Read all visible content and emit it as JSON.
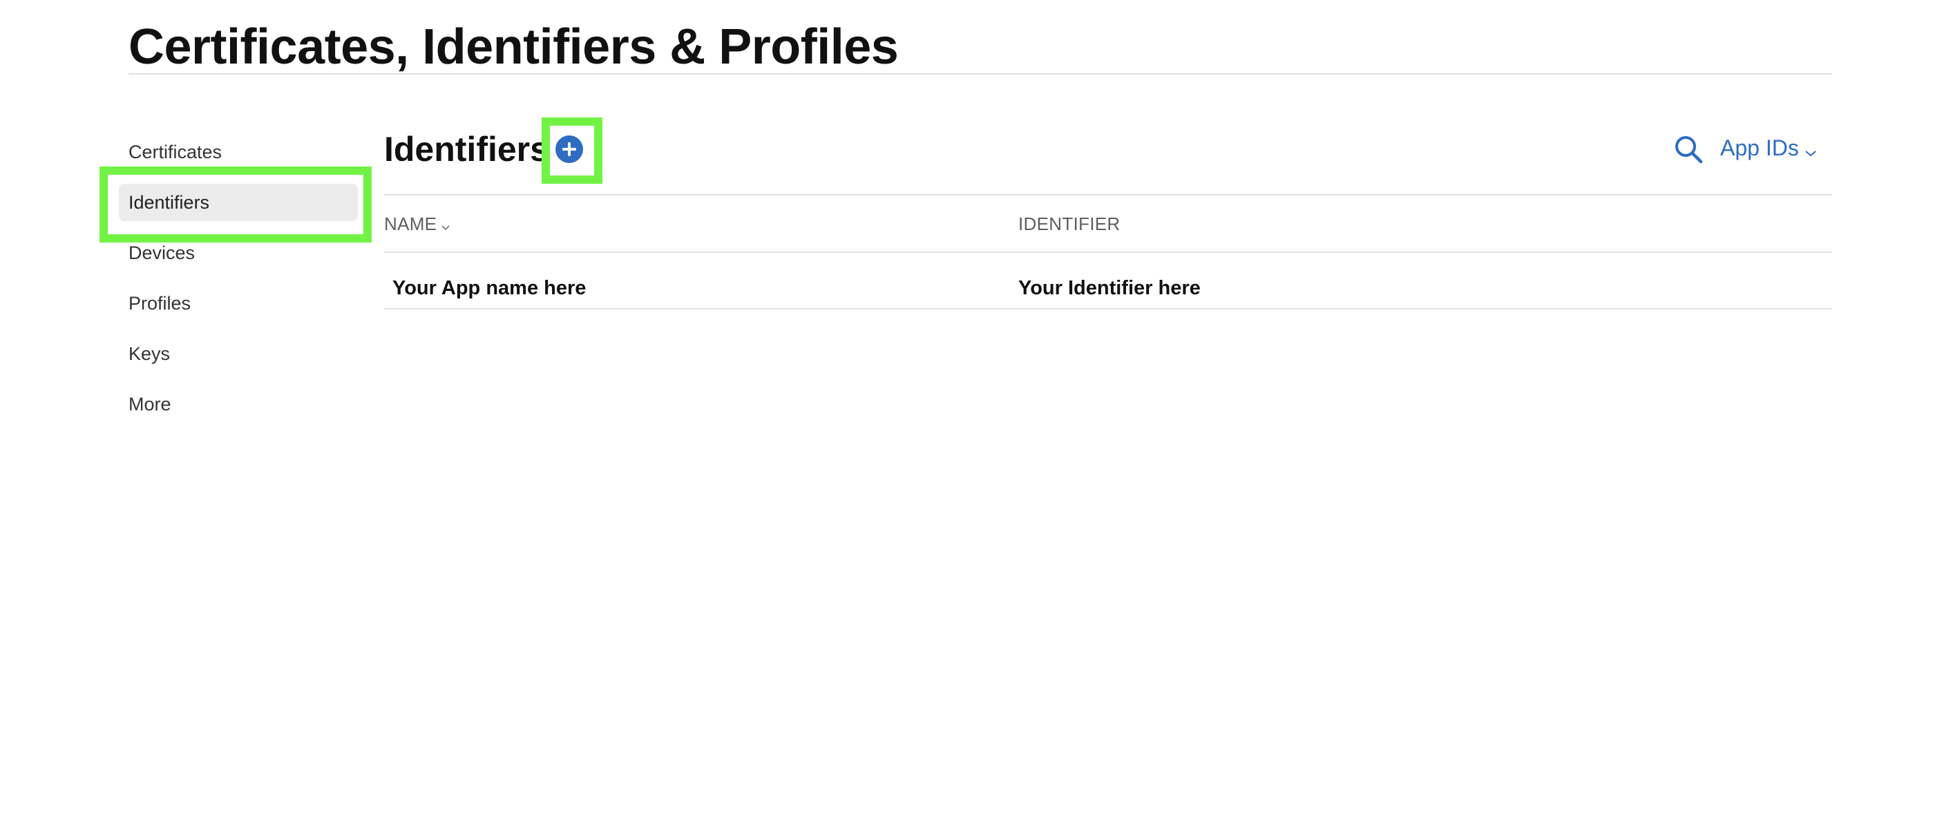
{
  "page": {
    "title": "Certificates, Identifiers & Profiles"
  },
  "sidebar": {
    "items": [
      {
        "label": "Certificates"
      },
      {
        "label": "Identifiers",
        "active": true
      },
      {
        "label": "Devices"
      },
      {
        "label": "Profiles"
      },
      {
        "label": "Keys"
      },
      {
        "label": "More"
      }
    ]
  },
  "section": {
    "title": "Identifiers",
    "add_icon": "plus-circle-icon",
    "search_icon": "search-icon",
    "filter_value": "App IDs"
  },
  "table": {
    "columns": [
      {
        "label": "NAME",
        "sortable": true
      },
      {
        "label": "IDENTIFIER"
      }
    ],
    "rows": [
      {
        "name": "Your App name here",
        "identifier": "Your Identifier here"
      }
    ]
  },
  "colors": {
    "accent": "#2d6cc0",
    "highlight": "#73f246",
    "active_bg": "#ececec"
  }
}
